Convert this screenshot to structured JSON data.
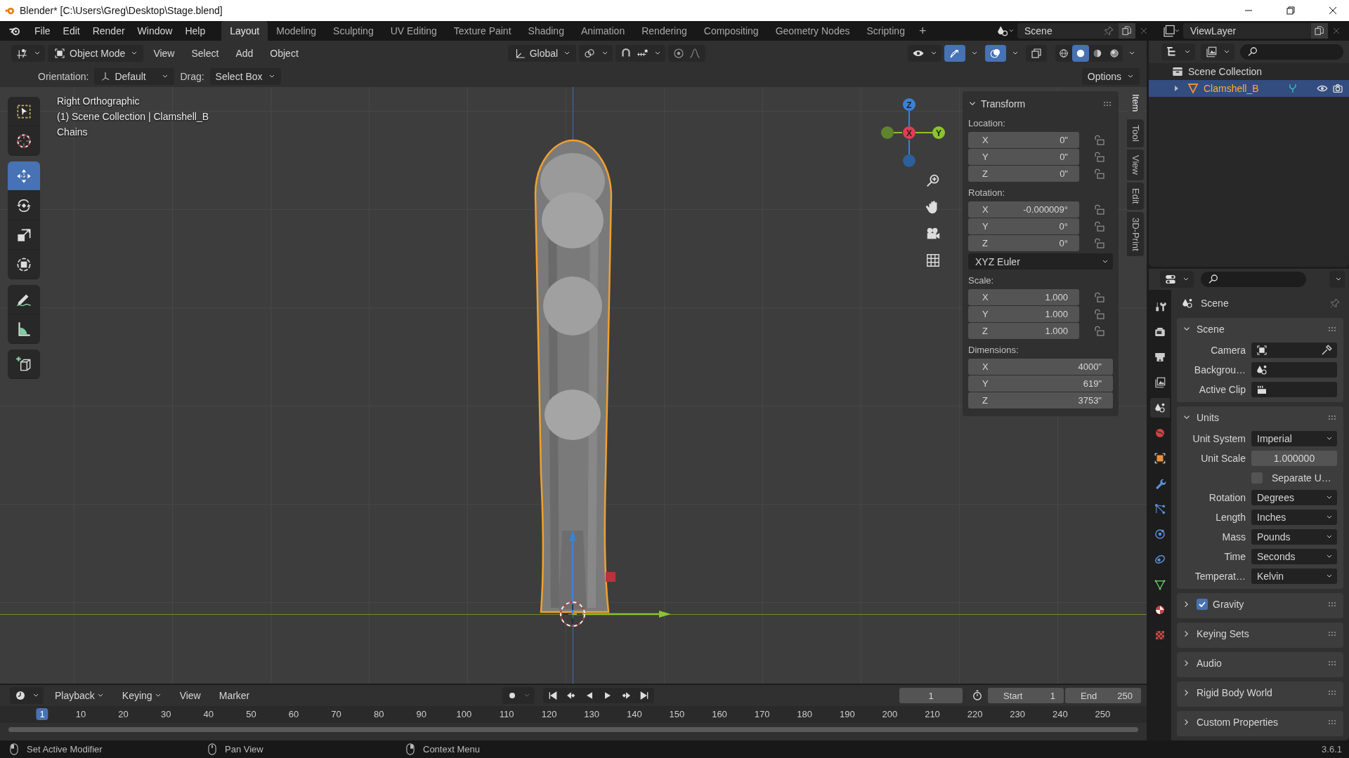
{
  "window": {
    "title": "Blender* [C:\\Users\\Greg\\Desktop\\Stage.blend]"
  },
  "menu": [
    "File",
    "Edit",
    "Render",
    "Window",
    "Help"
  ],
  "workspaces": [
    {
      "label": "Layout",
      "selected": true
    },
    {
      "label": "Modeling",
      "selected": false
    },
    {
      "label": "Sculpting",
      "selected": false
    },
    {
      "label": "UV Editing",
      "selected": false
    },
    {
      "label": "Texture Paint",
      "selected": false
    },
    {
      "label": "Shading",
      "selected": false
    },
    {
      "label": "Animation",
      "selected": false
    },
    {
      "label": "Rendering",
      "selected": false
    },
    {
      "label": "Compositing",
      "selected": false
    },
    {
      "label": "Geometry Nodes",
      "selected": false
    },
    {
      "label": "Scripting",
      "selected": false
    }
  ],
  "add_workspace": "+",
  "scene_field": {
    "value": "Scene"
  },
  "view_layer_field": {
    "value": "ViewLayer"
  },
  "viewport": {
    "header": {
      "mode": "Object Mode",
      "menus": [
        "View",
        "Select",
        "Add",
        "Object"
      ],
      "orientation": "Global",
      "gizmos_on": true,
      "overlays_on": true,
      "shading": [
        {
          "kind": "wireframe",
          "selected": false
        },
        {
          "kind": "solid",
          "selected": true
        },
        {
          "kind": "material",
          "selected": false
        },
        {
          "kind": "rendered",
          "selected": false
        }
      ]
    },
    "tool_settings": {
      "orientation_label": "Orientation:",
      "orientation": "Default",
      "drag_label": "Drag:",
      "drag": "Select Box",
      "options": "Options"
    },
    "tool_groups": [
      {
        "tools": [
          {
            "kind": "select_box",
            "selected": false
          },
          {
            "kind": "cursor",
            "selected": false
          }
        ]
      },
      {
        "tools": [
          {
            "kind": "move",
            "selected": true
          },
          {
            "kind": "rotate",
            "selected": false
          },
          {
            "kind": "scale",
            "selected": false
          },
          {
            "kind": "transform",
            "selected": false
          }
        ]
      },
      {
        "tools": [
          {
            "kind": "annotate",
            "selected": false
          },
          {
            "kind": "measure",
            "selected": false
          }
        ]
      },
      {
        "tools": [
          {
            "kind": "add_cube",
            "selected": false
          }
        ]
      }
    ],
    "overlay_text": [
      "Right Orthographic",
      "(1) Scene Collection | Clamshell_B",
      "Chains"
    ],
    "gizmo_axes": [
      {
        "kind": "z",
        "label": "Z"
      },
      {
        "kind": "x",
        "label": "X"
      },
      {
        "kind": "y",
        "label": "Y"
      }
    ],
    "sidebar_tabs": [
      {
        "label": "Item",
        "selected": true
      },
      {
        "label": "Tool",
        "selected": false
      },
      {
        "label": "View",
        "selected": false
      },
      {
        "label": "Edit",
        "selected": false
      },
      {
        "label": "3D-Print",
        "selected": false
      }
    ],
    "transform": {
      "title": "Transform",
      "expanded": true,
      "groups": [
        {
          "label": "Location:",
          "fields": [
            {
              "axis": "X",
              "value": "0\"",
              "locked": false
            },
            {
              "axis": "Y",
              "value": "0\"",
              "locked": false
            },
            {
              "axis": "Z",
              "value": "0\"",
              "locked": false
            }
          ]
        },
        {
          "label": "Rotation:",
          "fields": [
            {
              "axis": "X",
              "value": "-0.000009°",
              "locked": false
            },
            {
              "axis": "Y",
              "value": "0°",
              "locked": false
            },
            {
              "axis": "Z",
              "value": "0°",
              "locked": false
            }
          ],
          "mode": "XYZ Euler"
        },
        {
          "label": "Scale:",
          "fields": [
            {
              "axis": "X",
              "value": "1.000",
              "locked": false
            },
            {
              "axis": "Y",
              "value": "1.000",
              "locked": false
            },
            {
              "axis": "Z",
              "value": "1.000",
              "locked": false
            }
          ]
        },
        {
          "label": "Dimensions:",
          "fields": [
            {
              "axis": "X",
              "value": "4000\""
            },
            {
              "axis": "Y",
              "value": "619\""
            },
            {
              "axis": "Z",
              "value": "3753\""
            }
          ]
        }
      ]
    }
  },
  "timeline": {
    "menus": [
      "Playback",
      "Keying",
      "View",
      "Marker"
    ],
    "current_frame": "1",
    "start_label": "Start",
    "start": "1",
    "end_label": "End",
    "end": "250",
    "ticks": [
      {
        "label": "1",
        "selected": true
      },
      {
        "label": "10",
        "selected": false
      },
      {
        "label": "20",
        "selected": false
      },
      {
        "label": "30",
        "selected": false
      },
      {
        "label": "40",
        "selected": false
      },
      {
        "label": "50",
        "selected": false
      },
      {
        "label": "60",
        "selected": false
      },
      {
        "label": "70",
        "selected": false
      },
      {
        "label": "80",
        "selected": false
      },
      {
        "label": "90",
        "selected": false
      },
      {
        "label": "100",
        "selected": false
      },
      {
        "label": "110",
        "selected": false
      },
      {
        "label": "120",
        "selected": false
      },
      {
        "label": "130",
        "selected": false
      },
      {
        "label": "140",
        "selected": false
      },
      {
        "label": "150",
        "selected": false
      },
      {
        "label": "160",
        "selected": false
      },
      {
        "label": "170",
        "selected": false
      },
      {
        "label": "180",
        "selected": false
      },
      {
        "label": "190",
        "selected": false
      },
      {
        "label": "200",
        "selected": false
      },
      {
        "label": "210",
        "selected": false
      },
      {
        "label": "220",
        "selected": false
      },
      {
        "label": "230",
        "selected": false
      },
      {
        "label": "240",
        "selected": false
      },
      {
        "label": "250",
        "selected": false
      }
    ]
  },
  "outliner": {
    "items": [
      {
        "label": "Scene Collection",
        "selected": false,
        "expanded": true,
        "children": [
          {
            "label": "Clamshell_B",
            "selected": true,
            "expanded": false
          }
        ]
      }
    ]
  },
  "properties": {
    "context": "Scene",
    "tabs": [
      {
        "kind": "tool",
        "selected": false
      },
      {
        "kind": "render",
        "selected": false
      },
      {
        "kind": "output",
        "selected": false
      },
      {
        "kind": "view_layer",
        "selected": false
      },
      {
        "kind": "scene",
        "selected": true
      },
      {
        "kind": "world",
        "selected": false
      },
      {
        "kind": "object",
        "selected": false
      },
      {
        "kind": "modifiers",
        "selected": false
      },
      {
        "kind": "particles",
        "selected": false
      },
      {
        "kind": "physics",
        "selected": false
      },
      {
        "kind": "constraints",
        "selected": false
      },
      {
        "kind": "data",
        "selected": false
      },
      {
        "kind": "material",
        "selected": false
      },
      {
        "kind": "texture",
        "selected": false
      }
    ],
    "panels": [
      {
        "title": "Scene",
        "expanded": true,
        "rows": [
          {
            "kind": "camera",
            "label": "Camera"
          },
          {
            "kind": "background",
            "label": "Backgrou…"
          },
          {
            "kind": "clip",
            "label": "Active Clip"
          }
        ]
      },
      {
        "title": "Units",
        "expanded": true,
        "rows": [
          {
            "kind": "dropdown",
            "label": "Unit System",
            "value": "Imperial"
          },
          {
            "kind": "number",
            "label": "Unit Scale",
            "value": "1.000000"
          },
          {
            "kind": "checkbox",
            "label": "Separate U…",
            "checked": false
          },
          {
            "kind": "dropdown",
            "label": "Rotation",
            "value": "Degrees"
          },
          {
            "kind": "dropdown",
            "label": "Length",
            "value": "Inches"
          },
          {
            "kind": "dropdown",
            "label": "Mass",
            "value": "Pounds"
          },
          {
            "kind": "dropdown",
            "label": "Time",
            "value": "Seconds"
          },
          {
            "kind": "dropdown",
            "label": "Temperat…",
            "value": "Kelvin"
          }
        ]
      },
      {
        "title": "Gravity",
        "expanded": false,
        "checked": true
      },
      {
        "title": "Keying Sets",
        "expanded": false
      },
      {
        "title": "Audio",
        "expanded": false
      },
      {
        "title": "Rigid Body World",
        "expanded": false
      },
      {
        "title": "Custom Properties",
        "expanded": false
      }
    ]
  },
  "status_bar": {
    "hints": [
      {
        "kind": "left",
        "text": "Set Active Modifier"
      },
      {
        "kind": "middle",
        "text": "Pan View"
      },
      {
        "kind": "right",
        "text": "Context Menu"
      }
    ],
    "version": "3.6.1"
  }
}
